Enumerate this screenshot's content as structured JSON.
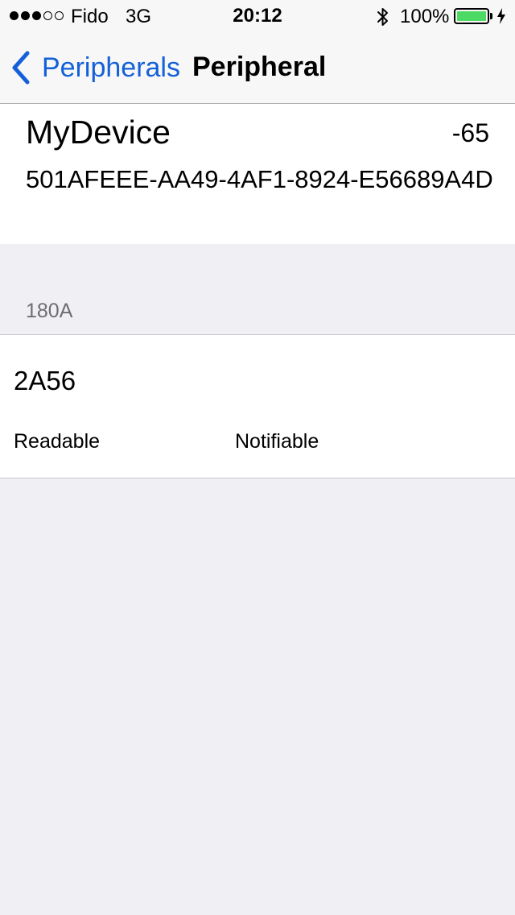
{
  "status_bar": {
    "carrier": "Fido",
    "network": "3G",
    "time": "20:12",
    "battery": "100%",
    "signal_strength": 3,
    "signal_max": 5,
    "icons": [
      "bluetooth-icon",
      "battery-icon",
      "charging-bolt-icon"
    ],
    "battery_color": "#4cd964"
  },
  "nav": {
    "back_label": "Peripherals",
    "title": "Peripheral",
    "accent_color": "#1360d8"
  },
  "device": {
    "name": "MyDevice",
    "rssi": "-65",
    "uuid": "501AFEEE-AA49-4AF1-8924-E56689A4D"
  },
  "service": {
    "uuid": "180A",
    "characteristics": [
      {
        "uuid": "2A56",
        "properties": [
          "Readable",
          "Notifiable"
        ]
      }
    ]
  }
}
